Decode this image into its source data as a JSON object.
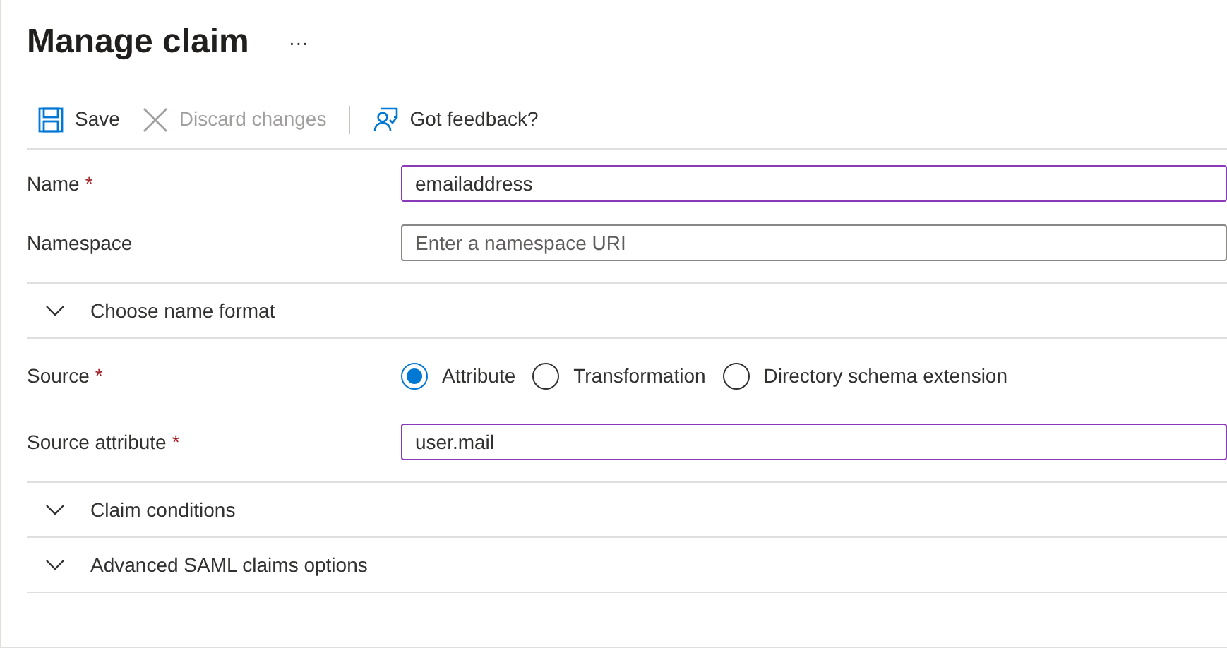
{
  "title": "Manage claim",
  "more": "···",
  "toolbar": [
    {
      "kind": "save",
      "label": "Save",
      "disabled": false
    },
    {
      "kind": "discard",
      "label": "Discard changes",
      "disabled": true
    },
    {
      "kind": "feedback",
      "label": "Got feedback?",
      "disabled": false
    }
  ],
  "rows": [
    {
      "kind": "text_field",
      "label": "Name",
      "required_mark": "*",
      "value": "emailaddress",
      "highlighted": true
    },
    {
      "kind": "text_field",
      "label": "Namespace",
      "placeholder": "Enter a namespace URI",
      "highlighted": false
    },
    {
      "kind": "collapsible",
      "label": "Choose name format",
      "expanded": false
    },
    {
      "kind": "radio_group",
      "label": "Source",
      "required_mark": "*",
      "options": [
        {
          "label": "Attribute",
          "selected": true
        },
        {
          "label": "Transformation",
          "selected": false
        },
        {
          "label": "Directory schema extension",
          "selected": false
        }
      ]
    },
    {
      "kind": "text_field",
      "label": "Source attribute",
      "required_mark": "*",
      "value": "user.mail",
      "highlighted": true
    },
    {
      "kind": "collapsible",
      "label": "Claim conditions",
      "expanded": false
    },
    {
      "kind": "collapsible",
      "label": "Advanced SAML claims options",
      "expanded": false
    }
  ]
}
